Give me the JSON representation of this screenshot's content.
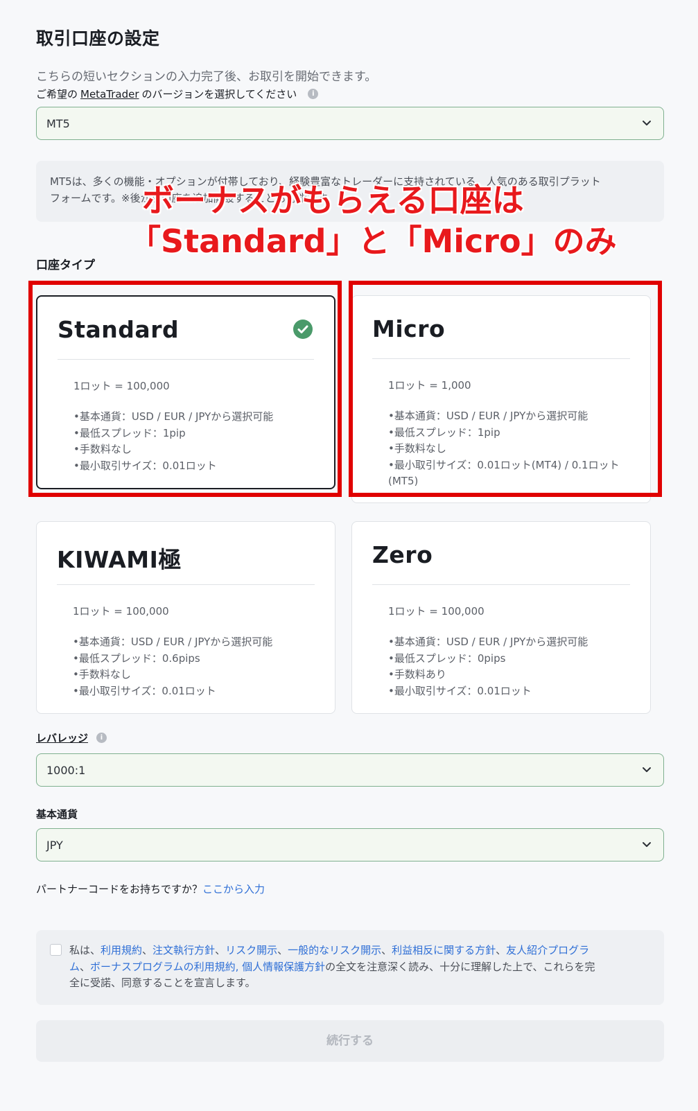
{
  "header": {
    "title": "取引口座の設定",
    "subtitle": "こちらの短いセクションの入力完了後、お取引を開始できます。"
  },
  "platform": {
    "label_prefix": "ご希望の",
    "label_link": "MetaTrader",
    "label_suffix": "のバージョンを選択してください",
    "selected": "MT5",
    "desc_line1": "MT5は、多くの機能・オプションが付帯しており、経験豊富なトレーダーに支持されている、人気のある取引プラット",
    "desc_line2": "フォームです。※後から口座を追加開設することも可能です。"
  },
  "account_type": {
    "label": "口座タイプ",
    "cards": [
      {
        "name": "Standard",
        "lot": "1ロット = 100,000",
        "specs": [
          "•基本通貨：USD / EUR / JPYから選択可能",
          "•最低スプレッド：1pip",
          "•手数料なし",
          "•最小取引サイズ：0.01ロット"
        ],
        "selected": true
      },
      {
        "name": "Micro",
        "lot": "1ロット = 1,000",
        "specs": [
          "•基本通貨：USD / EUR / JPYから選択可能",
          "•最低スプレッド：1pip",
          "•手数料なし",
          "•最小取引サイズ：0.01ロット(MT4) / 0.1ロット",
          "(MT5)"
        ],
        "selected": false
      },
      {
        "name": "KIWAMI極",
        "lot": "1ロット = 100,000",
        "specs": [
          "•基本通貨：USD / EUR / JPYから選択可能",
          "•最低スプレッド：0.6pips",
          "•手数料なし",
          "•最小取引サイズ：0.01ロット"
        ],
        "selected": false
      },
      {
        "name": "Zero",
        "lot": "1ロット = 100,000",
        "specs": [
          "•基本通貨：USD / EUR / JPYから選択可能",
          "•最低スプレッド：0pips",
          "•手数料あり",
          "•最小取引サイズ：0.01ロット"
        ],
        "selected": false
      }
    ]
  },
  "annotation": {
    "line1": "ボーナスがもらえる口座は",
    "line2": "「Standard」と「Micro」のみ",
    "color": "#e8191c"
  },
  "leverage": {
    "label": "レバレッジ",
    "selected": "1000:1"
  },
  "currency": {
    "label": "基本通貨",
    "selected": "JPY"
  },
  "partner": {
    "question": "パートナーコードをお持ちですか？",
    "link": "ここから入力"
  },
  "terms": {
    "t0": "私は、",
    "l1": "利用規約",
    "t1": "、",
    "l2": "注文執行方針",
    "t2": "、",
    "l3": "リスク開示",
    "t3": "、",
    "l4": "一般的なリスク開示",
    "t4": "、",
    "l5": "利益相反に関する方針",
    "t5": "、",
    "l6a": "友人紹介プログラ",
    "l6b": "ム",
    "t6": "、",
    "l7": "ボーナスプログラムの利用規約",
    "t7": ", ",
    "l8": "個人情報保護方針",
    "t8": "の全文を注意深く読み、十分に理解した上で、これらを完",
    "t9": "全に受諾、同意することを宣言します。"
  },
  "continue_label": "続行する",
  "colors": {
    "accent_green": "#4a9a6a",
    "link_blue": "#2f6fd6",
    "highlight_red": "#e00000"
  }
}
